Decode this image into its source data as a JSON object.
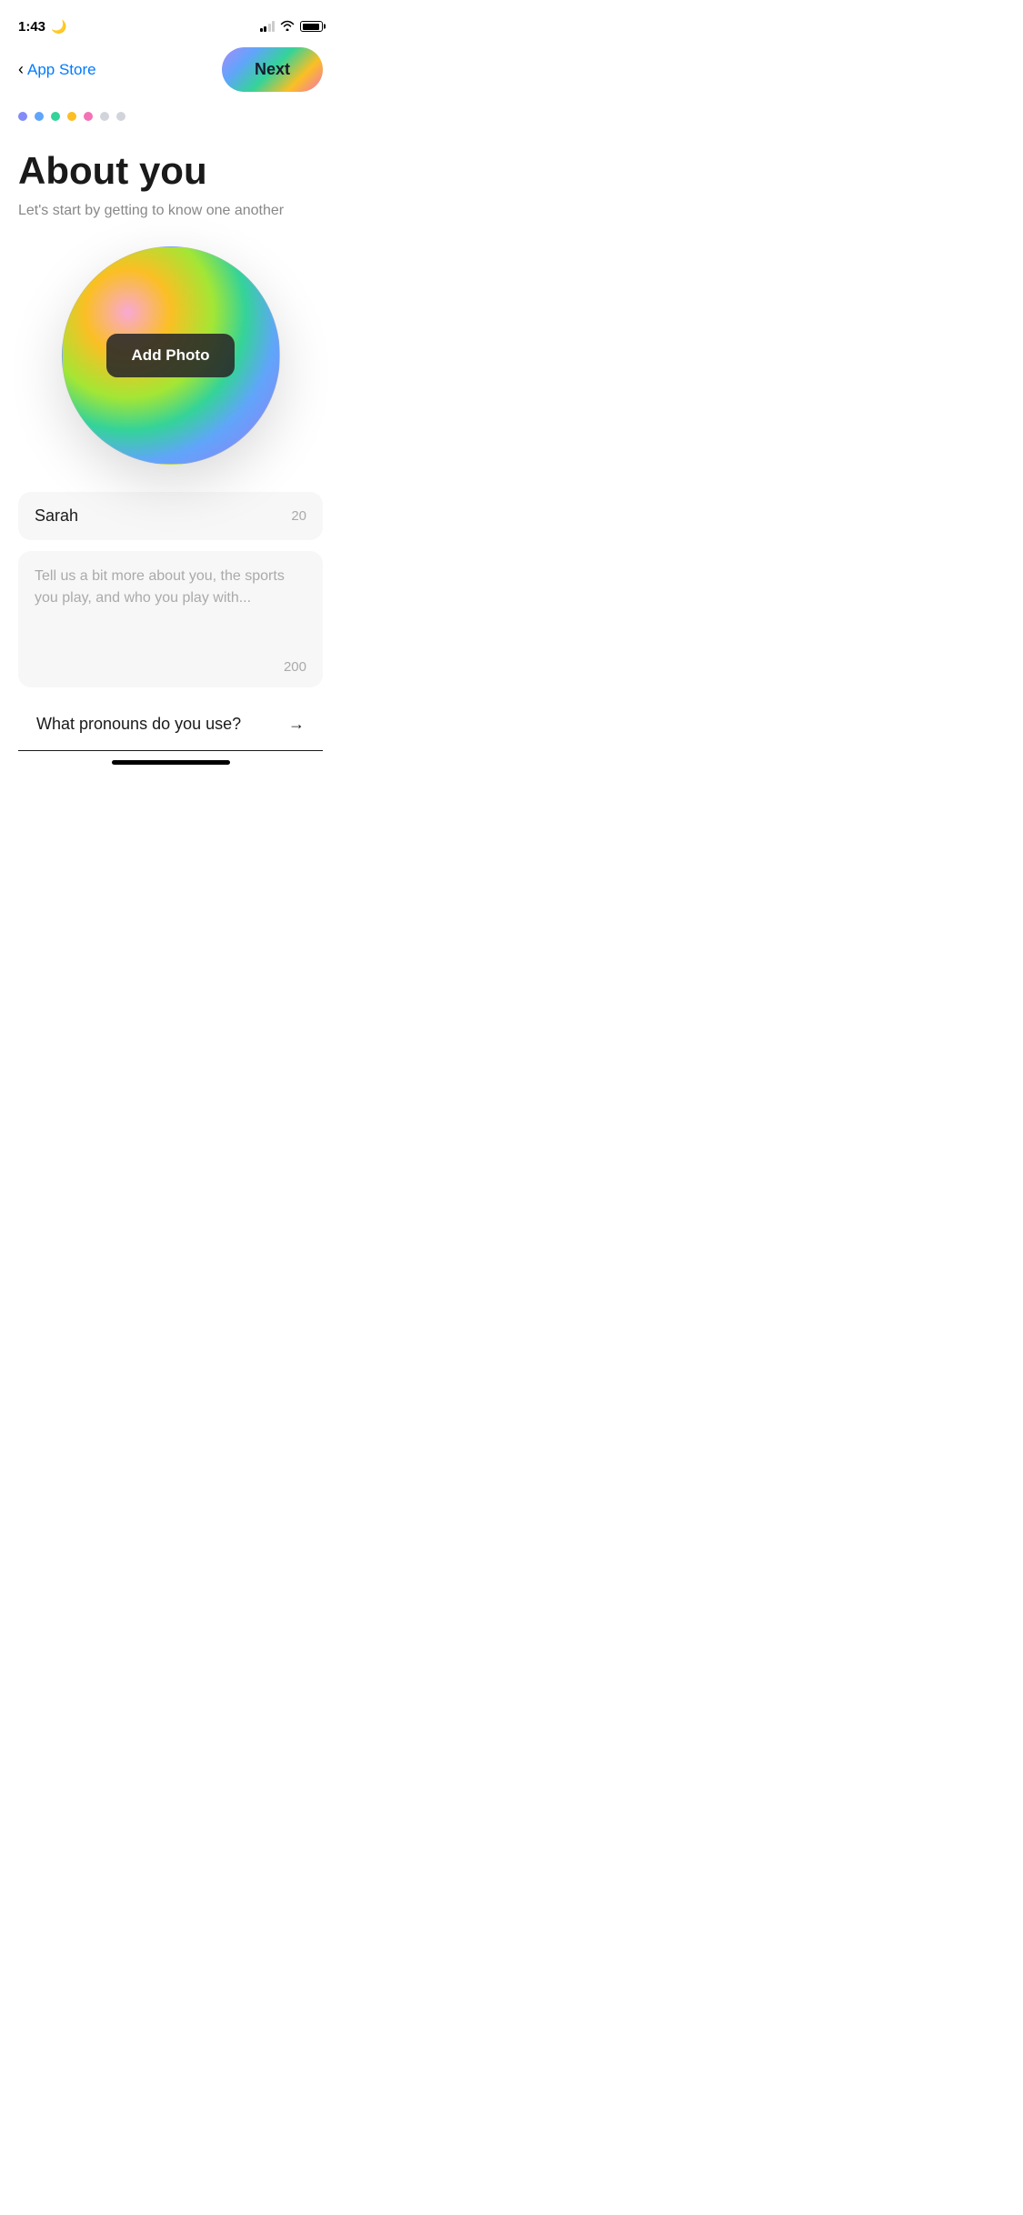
{
  "statusBar": {
    "time": "1:43",
    "moonIcon": "🌙"
  },
  "nav": {
    "backLabel": "App Store",
    "nextLabel": "Next"
  },
  "progressDots": [
    {
      "color": "#818cf8",
      "active": true
    },
    {
      "color": "#60a5fa",
      "active": true
    },
    {
      "color": "#34d399",
      "active": true
    },
    {
      "color": "#fbbf24",
      "active": true
    },
    {
      "color": "#f472b6",
      "active": true
    },
    {
      "color": "#d1d5db",
      "active": false
    },
    {
      "color": "#d1d5db",
      "active": false
    }
  ],
  "page": {
    "title": "About you",
    "subtitle": "Let's start by getting to know one another"
  },
  "photoSection": {
    "addPhotoLabel": "Add Photo"
  },
  "nameField": {
    "value": "Sarah",
    "charCount": "20"
  },
  "bioField": {
    "placeholder": "Tell us a bit more about you, the sports you play, and who you play with...",
    "charCount": "200"
  },
  "pronounsRow": {
    "label": "What pronouns do you use?",
    "arrowIcon": "→"
  }
}
